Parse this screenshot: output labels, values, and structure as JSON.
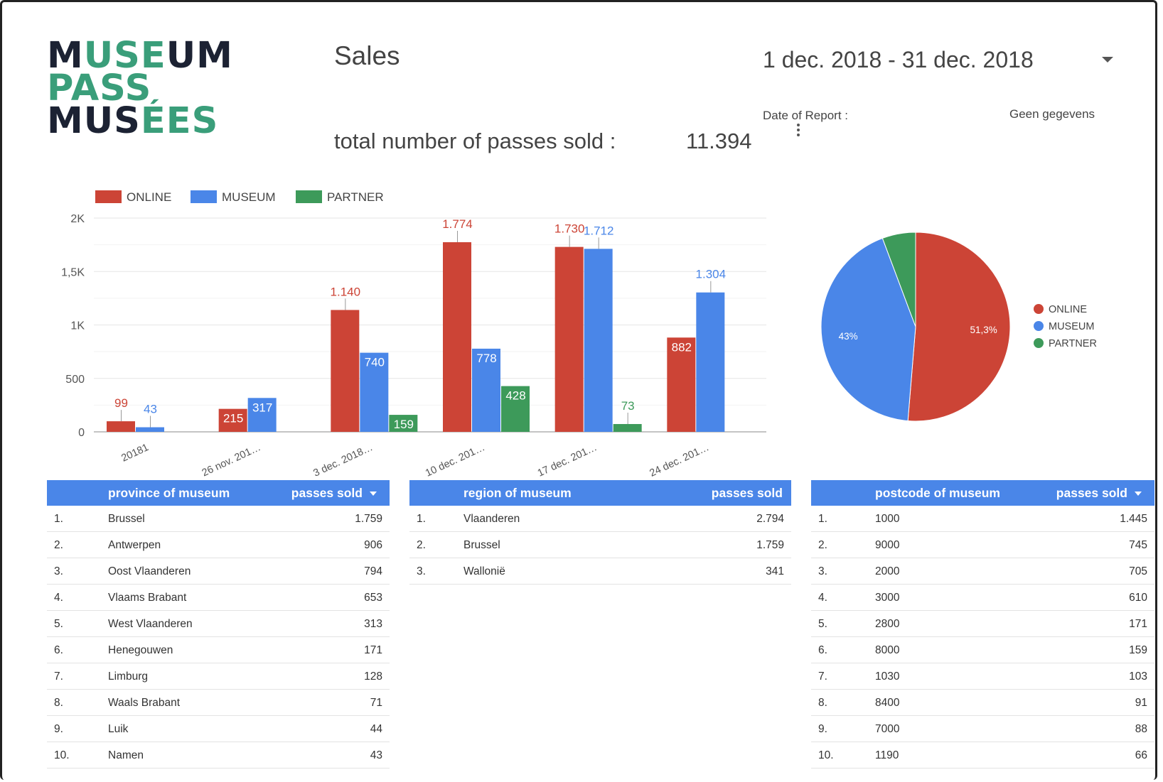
{
  "logo": {
    "line1a": "M",
    "line1b": "USE",
    "line1c": "UM",
    "line2": "PASS",
    "line3a": "MUS",
    "line3b": "ÉES"
  },
  "header": {
    "title": "Sales",
    "date_range": "1 dec. 2018 - 31 dec. 2018",
    "date_of_report_label": "Date of Report :",
    "date_of_report_value": "Geen gegevens",
    "kpi_label": "total number of passes sold :",
    "kpi_value": "11.394"
  },
  "colors": {
    "online": "#cc4436",
    "museum": "#4a86e8",
    "partner": "#3d9a5a",
    "header_bg": "#4a86e8"
  },
  "chart_data": [
    {
      "type": "bar",
      "legend": [
        "ONLINE",
        "MUSEUM",
        "PARTNER"
      ],
      "categories": [
        "20181",
        "26 nov. 201…",
        "3 dec. 2018…",
        "10 dec. 201…",
        "17 dec. 201…",
        "24 dec. 201…"
      ],
      "series": [
        {
          "name": "ONLINE",
          "values": [
            99,
            215,
            1140,
            1774,
            1730,
            882
          ],
          "labels": [
            "99",
            "215",
            "1.140",
            "1.774",
            "1.730",
            "882"
          ]
        },
        {
          "name": "MUSEUM",
          "values": [
            43,
            317,
            740,
            778,
            1712,
            1304
          ],
          "labels": [
            "43",
            "317",
            "740",
            "778",
            "1.712",
            "1.304"
          ]
        },
        {
          "name": "PARTNER",
          "values": [
            null,
            null,
            159,
            428,
            73,
            null
          ],
          "labels": [
            "",
            "",
            "159",
            "428",
            "73",
            ""
          ]
        }
      ],
      "yticks": [
        "0",
        "500",
        "1K",
        "1,5K",
        "2K"
      ],
      "ylim": [
        0,
        2000
      ]
    },
    {
      "type": "pie",
      "legend": [
        "ONLINE",
        "MUSEUM",
        "PARTNER"
      ],
      "values": [
        51.3,
        43,
        5.7
      ],
      "labels": [
        "51,3%",
        "43%",
        ""
      ]
    }
  ],
  "tables": {
    "province": {
      "col1": "province of museum",
      "col2": "passes sold",
      "rows": [
        {
          "n": "1.",
          "name": "Brussel",
          "v": "1.759"
        },
        {
          "n": "2.",
          "name": "Antwerpen",
          "v": "906"
        },
        {
          "n": "3.",
          "name": "Oost Vlaanderen",
          "v": "794"
        },
        {
          "n": "4.",
          "name": "Vlaams Brabant",
          "v": "653"
        },
        {
          "n": "5.",
          "name": "West Vlaanderen",
          "v": "313"
        },
        {
          "n": "6.",
          "name": "Henegouwen",
          "v": "171"
        },
        {
          "n": "7.",
          "name": "Limburg",
          "v": "128"
        },
        {
          "n": "8.",
          "name": "Waals Brabant",
          "v": "71"
        },
        {
          "n": "9.",
          "name": "Luik",
          "v": "44"
        },
        {
          "n": "10.",
          "name": "Namen",
          "v": "43"
        }
      ]
    },
    "region": {
      "col1": "region of museum",
      "col2": "passes sold",
      "rows": [
        {
          "n": "1.",
          "name": "Vlaanderen",
          "v": "2.794"
        },
        {
          "n": "2.",
          "name": "Brussel",
          "v": "1.759"
        },
        {
          "n": "3.",
          "name": "Wallonië",
          "v": "341"
        }
      ]
    },
    "postcode": {
      "col1": "postcode of museum",
      "col2": "passes sold",
      "rows": [
        {
          "n": "1.",
          "name": "1000",
          "v": "1.445"
        },
        {
          "n": "2.",
          "name": "9000",
          "v": "745"
        },
        {
          "n": "3.",
          "name": "2000",
          "v": "705"
        },
        {
          "n": "4.",
          "name": "3000",
          "v": "610"
        },
        {
          "n": "5.",
          "name": "2800",
          "v": "171"
        },
        {
          "n": "6.",
          "name": "8000",
          "v": "159"
        },
        {
          "n": "7.",
          "name": "1030",
          "v": "103"
        },
        {
          "n": "8.",
          "name": "8400",
          "v": "91"
        },
        {
          "n": "9.",
          "name": "7000",
          "v": "88"
        },
        {
          "n": "10.",
          "name": "1190",
          "v": "66"
        }
      ]
    }
  }
}
